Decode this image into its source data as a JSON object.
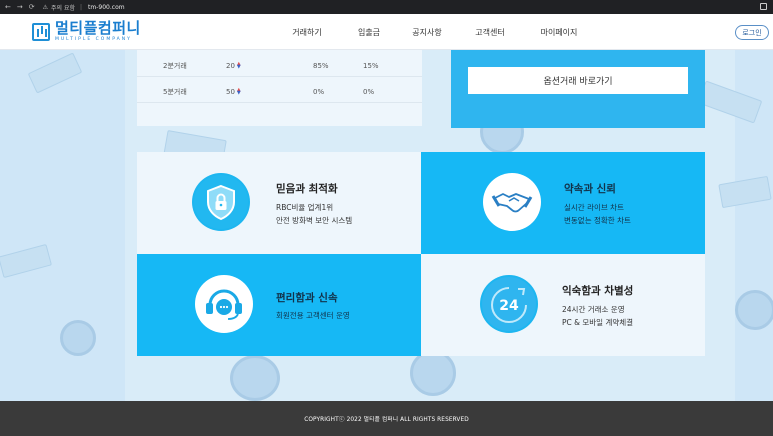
{
  "browser": {
    "security_label": "주의 요함",
    "url": "tm-900.com"
  },
  "header": {
    "logo_title": "멀티플컴퍼니",
    "logo_sub": "MULTIPLE COMPANY",
    "nav": [
      "거래하기",
      "입출금",
      "공지사항",
      "고객센터",
      "마이페이지"
    ],
    "login_label": "로그인"
  },
  "trade_table": {
    "rows": [
      {
        "name": "2분거래",
        "count": "20",
        "p1": "85%",
        "p2": "15%"
      },
      {
        "name": "5분거래",
        "count": "50",
        "p1": "0%",
        "p2": "0%"
      }
    ]
  },
  "option": {
    "button_label": "옵션거래 바로가기"
  },
  "features": [
    {
      "title": "믿음과 최적화",
      "lines": [
        "RBC비율 업계1위",
        "안전 방화벽 보안 시스템"
      ],
      "icon": "shield-lock-icon"
    },
    {
      "title": "약속과 신뢰",
      "lines": [
        "실시간 라이브 차트",
        "변동없는 정확한 차트"
      ],
      "icon": "handshake-icon"
    },
    {
      "title": "편리함과 신속",
      "lines": [
        "회원전용 고객센터 운영"
      ],
      "icon": "headset-icon"
    },
    {
      "title": "익숙함과 차별성",
      "lines": [
        "24시간 거래소 운영",
        "PC & 모바일 계약체결"
      ],
      "icon": "clock-24-icon",
      "icon_text": "24"
    }
  ],
  "footer": {
    "copyright": "COPYRIGHTⓒ 2022 멀티플 컴퍼니 ALL RIGHTS RESERVED"
  },
  "colors": {
    "accent_blue": "#16b8f5",
    "option_panel": "#2fb5ef",
    "logo_blue": "#1a7ecf",
    "footer_bg": "#3a3a3a",
    "up_arrow": "#e24b4b",
    "down_arrow": "#3a63c8"
  }
}
